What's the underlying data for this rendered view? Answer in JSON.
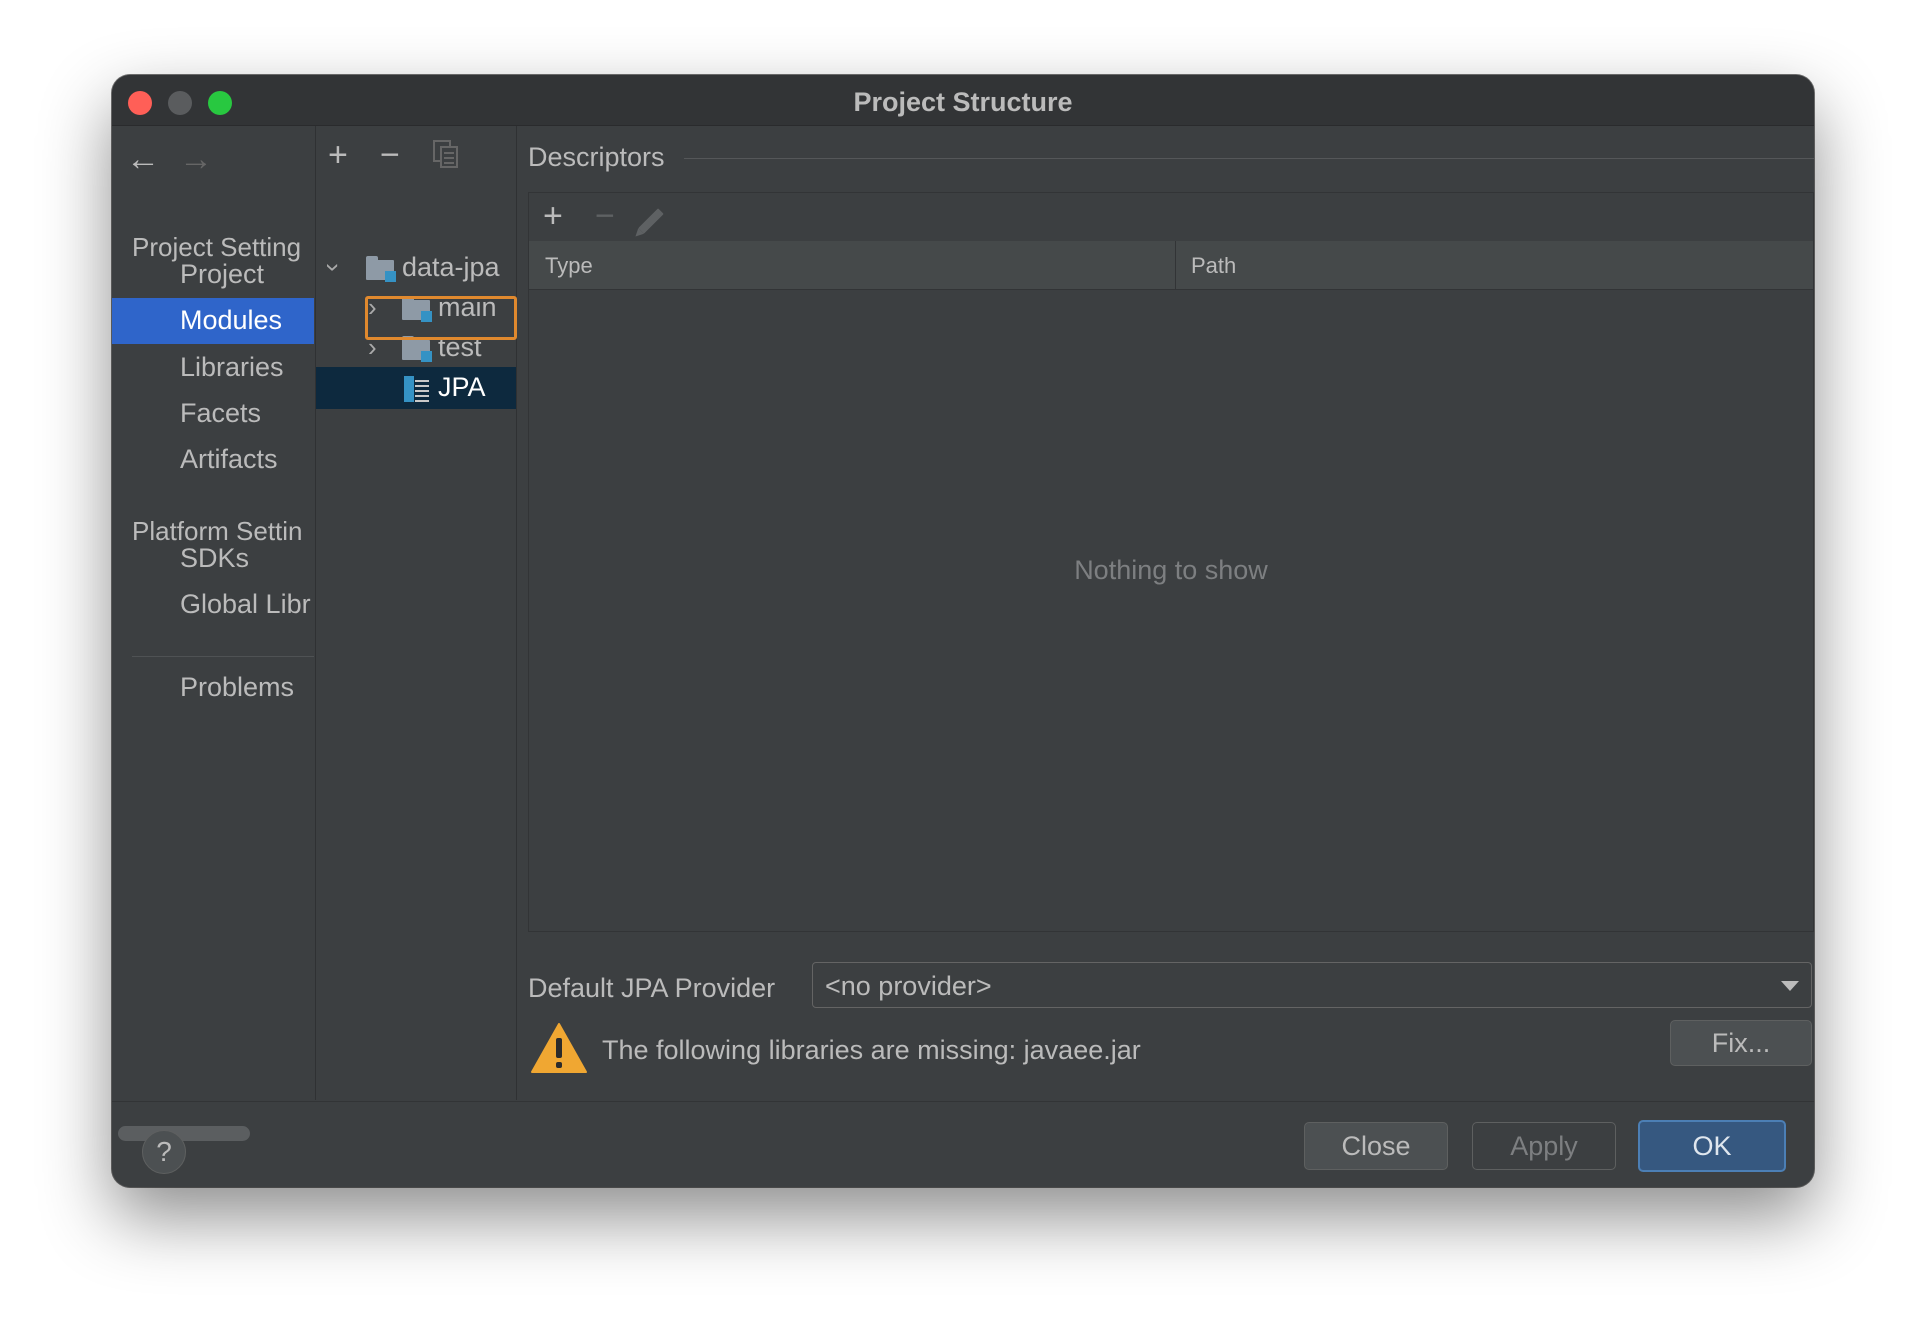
{
  "window": {
    "title": "Project Structure"
  },
  "nav": {
    "back_icon": "←",
    "forward_icon": "→",
    "project_settings_header": "Project Setting",
    "platform_settings_header": "Platform Settin",
    "items": [
      {
        "label": "Project"
      },
      {
        "label": "Modules",
        "selected": true
      },
      {
        "label": "Libraries"
      },
      {
        "label": "Facets"
      },
      {
        "label": "Artifacts"
      },
      {
        "label": "SDKs"
      },
      {
        "label": "Global Libr"
      },
      {
        "label": "Problems"
      }
    ]
  },
  "tree": {
    "toolbar": {
      "add": "+",
      "remove": "−",
      "copy_icon": "copy-icon"
    },
    "nodes": [
      {
        "label": "data-jpa",
        "expanded": true
      },
      {
        "label": "main",
        "expanded": false
      },
      {
        "label": "test",
        "expanded": false
      },
      {
        "label": "JPA",
        "selected": true
      }
    ]
  },
  "descriptors": {
    "title": "Descriptors",
    "toolbar": {
      "add": "+",
      "remove": "−"
    },
    "columns": [
      "Type",
      "Path"
    ],
    "empty_text": "Nothing to show"
  },
  "provider": {
    "label": "Default JPA Provider",
    "value": "<no provider>"
  },
  "warning": {
    "text": "The following libraries are missing: javaee.jar",
    "fix_label": "Fix..."
  },
  "footer": {
    "help_label": "?",
    "close_label": "Close",
    "apply_label": "Apply",
    "ok_label": "OK"
  },
  "colors": {
    "selection": "#2f65ca",
    "focus_outline": "#e0892e",
    "primary_button": "#365880"
  }
}
